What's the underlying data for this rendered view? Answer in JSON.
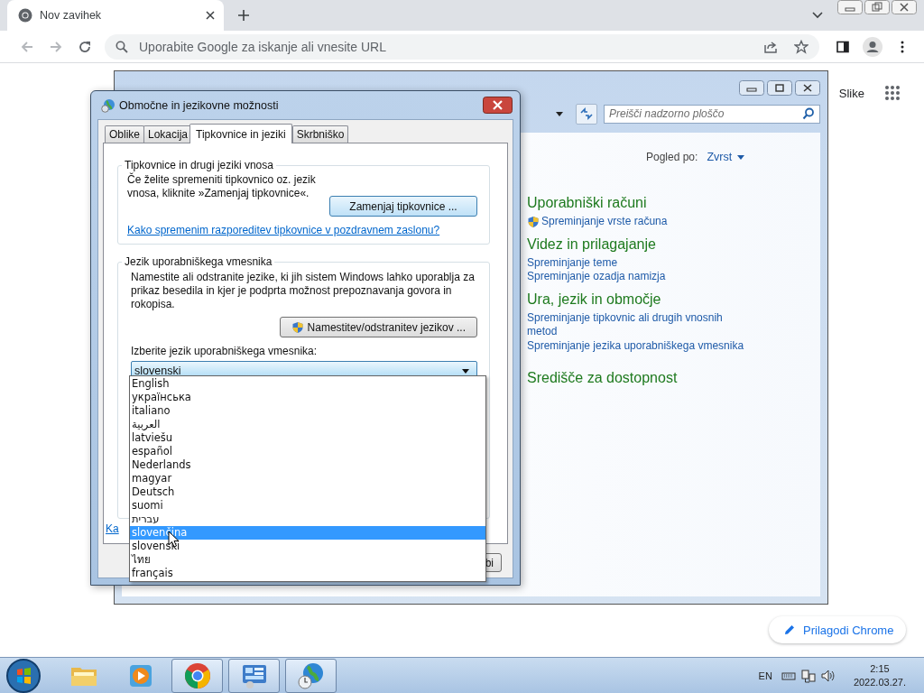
{
  "browser": {
    "tab": {
      "title": "Nov zavihek"
    },
    "address": {
      "placeholder": "Uporabite Google za iskanje ali vnesite URL"
    },
    "page_link": "Slike",
    "customize_button": "Prilagodi Chrome"
  },
  "control_panel": {
    "search": {
      "placeholder": "Preišči nadzorno ploščo"
    },
    "view_label": "Pogled po:",
    "view_value": "Zvrst",
    "categories": [
      {
        "title": "Uporabniški računi",
        "links": [
          {
            "text": "Spreminjanje vrste računa",
            "shield": true
          }
        ]
      },
      {
        "title": "Videz in prilagajanje",
        "links": [
          {
            "text": "Spreminjanje teme",
            "shield": false
          },
          {
            "text": "Spreminjanje ozadja namizja",
            "shield": false
          }
        ]
      },
      {
        "title": "Ura, jezik in območje",
        "links": [
          {
            "text": "Spreminjanje tipkovnic ali drugih vnosnih metod",
            "shield": false
          },
          {
            "text": "Spreminjanje jezika uporabniškega vmesnika",
            "shield": false
          }
        ]
      },
      {
        "title": "Središče za dostopnost"
      }
    ]
  },
  "dialog": {
    "title": "Območne in jezikovne možnosti",
    "tabs": [
      {
        "label": "Oblike",
        "selected": false
      },
      {
        "label": "Lokacija",
        "selected": false
      },
      {
        "label": "Tipkovnice in jeziki",
        "selected": true
      },
      {
        "label": "Skrbniško",
        "selected": false
      }
    ],
    "keyboards_group": {
      "title": "Tipkovnice in drugi jeziki vnosa",
      "text": "Če želite spremeniti tipkovnico oz. jezik vnosa, kliknite »Zamenjaj tipkovnice«.",
      "button": "Zamenjaj tipkovnice ...",
      "link": "Kako spremenim razporeditev tipkovnice v pozdravnem zaslonu?"
    },
    "ui_language_group": {
      "title": "Jezik uporabniškega vmesnika",
      "text": "Namestite ali odstranite jezike, ki jih sistem Windows lahko uporablja za prikaz besedila in kjer je podprta možnost prepoznavanja govora in rokopisa.",
      "button": "Namestitev/odstranitev jezikov ...",
      "select_label": "Izberite jezik uporabniškega vmesnika:",
      "select_value": "slovenski"
    },
    "cut_link": "Ka",
    "cut_button": "bi"
  },
  "dropdown": {
    "items": [
      {
        "label": "English",
        "selected": false
      },
      {
        "label": "українська",
        "selected": false
      },
      {
        "label": "italiano",
        "selected": false
      },
      {
        "label": "العربية",
        "selected": false
      },
      {
        "label": "latviešu",
        "selected": false
      },
      {
        "label": "español",
        "selected": false
      },
      {
        "label": "Nederlands",
        "selected": false
      },
      {
        "label": "magyar",
        "selected": false
      },
      {
        "label": "Deutsch",
        "selected": false
      },
      {
        "label": "suomi",
        "selected": false
      },
      {
        "label": "עברית",
        "selected": false
      },
      {
        "label": "slovenčina",
        "selected": true
      },
      {
        "label": "slovenski",
        "selected": false
      },
      {
        "label": "ไทย",
        "selected": false
      },
      {
        "label": "français",
        "selected": false
      }
    ]
  },
  "taskbar": {
    "apps": [
      {
        "kind": "explorer",
        "active": false
      },
      {
        "kind": "media",
        "active": false
      },
      {
        "kind": "chrome",
        "active": true
      },
      {
        "kind": "control-panel",
        "active": true
      },
      {
        "kind": "clock-globe",
        "active": true
      }
    ],
    "language": "EN",
    "time": "2:15",
    "date": "2022.03.27."
  }
}
